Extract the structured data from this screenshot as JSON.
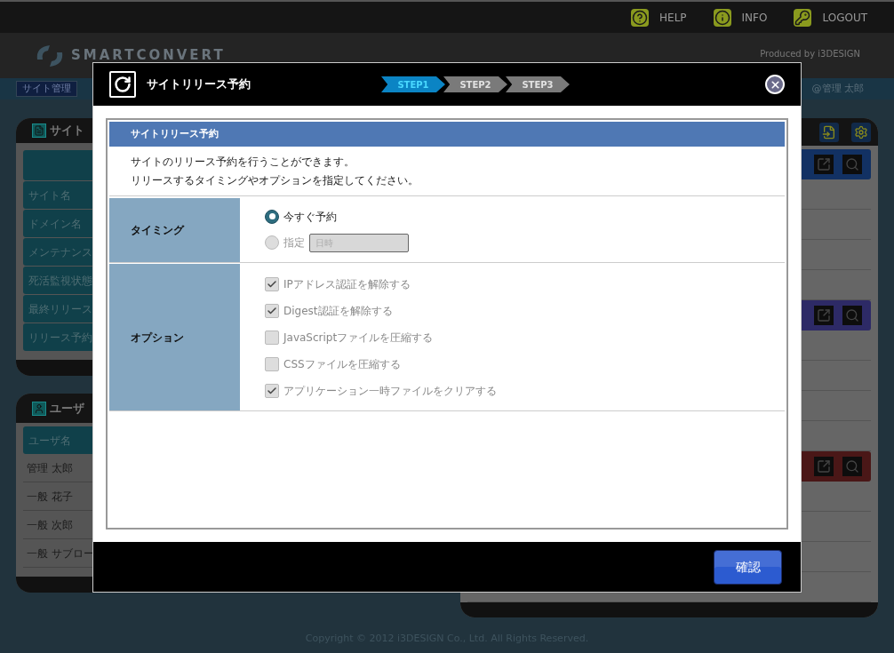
{
  "header": {
    "links": [
      {
        "label": "HELP",
        "kind": "help"
      },
      {
        "label": "INFO",
        "kind": "info"
      },
      {
        "label": "LOGOUT",
        "kind": "logout"
      }
    ],
    "logo": "SMARTCONVERT",
    "produced_by": "Produced by i3DESIGN"
  },
  "nav": {
    "tab": "サイト管理",
    "user": "@管理 太郎"
  },
  "site_panel": {
    "title": "サイト",
    "rows": [
      "サイト名",
      "ドメイン名",
      "メンテナンス",
      "死活監視状態",
      "最終リリース",
      "リリース予約"
    ]
  },
  "user_panel": {
    "title": "ユーザ",
    "column": "ユーザ名",
    "rows": [
      "管理 太郎",
      "一般 花子",
      "一般 次郎",
      "一般 サブロー"
    ]
  },
  "record_groups": [
    {
      "color": "#123163"
    },
    {
      "color": "#2d2a66"
    },
    {
      "color": "#4a1717"
    }
  ],
  "footer": "Copyright © 2012 i3DESIGN Co., Ltd. All Rights Reserved.",
  "modal": {
    "title": "サイトリリース予約",
    "steps": [
      {
        "label": "STEP1",
        "selected": true
      },
      {
        "label": "STEP2",
        "selected": false
      },
      {
        "label": "STEP3",
        "selected": false
      }
    ],
    "section_title": "サイトリリース予約",
    "description": [
      "サイトのリリース予約を行うことができます。",
      "リリースするタイミングやオプションを指定してください。"
    ],
    "timing": {
      "label": "タイミング",
      "options": [
        {
          "label": "今すぐ予約",
          "selected": true,
          "disabled": false,
          "kind": "plain"
        },
        {
          "label": "指定",
          "selected": false,
          "disabled": true,
          "kind": "datetime",
          "placeholder": "日時"
        }
      ]
    },
    "options": {
      "label": "オプション",
      "items": [
        {
          "label": "IPアドレス認証を解除する",
          "checked": true,
          "disabled": true
        },
        {
          "label": "Digest認証を解除する",
          "checked": true,
          "disabled": true
        },
        {
          "label": "JavaScriptファイルを圧縮する",
          "checked": false,
          "disabled": true
        },
        {
          "label": "CSSファイルを圧縮する",
          "checked": false,
          "disabled": true
        },
        {
          "label": "アプリケーション一時ファイルをクリアする",
          "checked": true,
          "disabled": true
        }
      ]
    },
    "confirm": "確認"
  }
}
